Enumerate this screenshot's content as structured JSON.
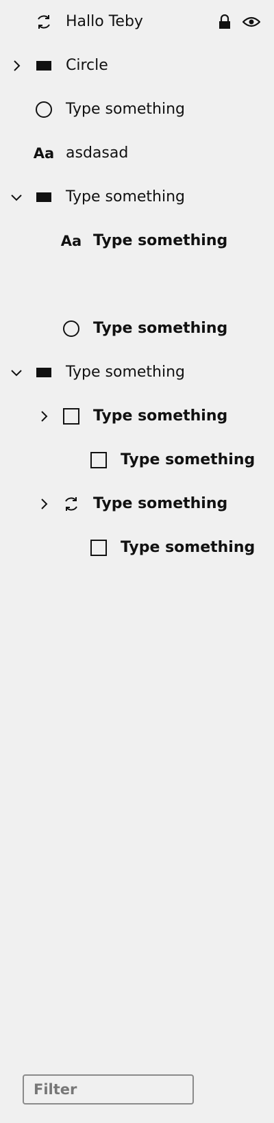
{
  "layers": [
    {
      "label": "Hallo Teby",
      "icon": "rotate-icon",
      "bold": false,
      "locked": true,
      "visible": true
    },
    {
      "label": "Circle",
      "icon": "filled-rect-icon",
      "bold": false,
      "expander": "collapsed"
    },
    {
      "label": "Type something",
      "icon": "circle-icon",
      "bold": false
    },
    {
      "label": "asdasad",
      "icon": "text-icon",
      "icon_text": "Aa",
      "bold": false
    },
    {
      "label": "Type something",
      "icon": "filled-rect-icon",
      "bold": false,
      "expander": "expanded"
    },
    {
      "label": "Type something",
      "icon": "text-icon",
      "icon_text": "Aa",
      "bold": true
    },
    {
      "label": "Type something",
      "icon": "circle-icon",
      "bold": true
    },
    {
      "label": "Type something",
      "icon": "filled-rect-icon",
      "bold": false,
      "expander": "expanded"
    },
    {
      "label": "Type something",
      "icon": "square-icon",
      "bold": true,
      "expander": "collapsed"
    },
    {
      "label": "Type something",
      "icon": "square-icon",
      "bold": true
    },
    {
      "label": "Type something",
      "icon": "rotate-icon",
      "bold": true,
      "expander": "collapsed"
    },
    {
      "label": "Type something",
      "icon": "square-icon",
      "bold": true
    }
  ],
  "filter": {
    "placeholder": "Filter",
    "value": ""
  }
}
